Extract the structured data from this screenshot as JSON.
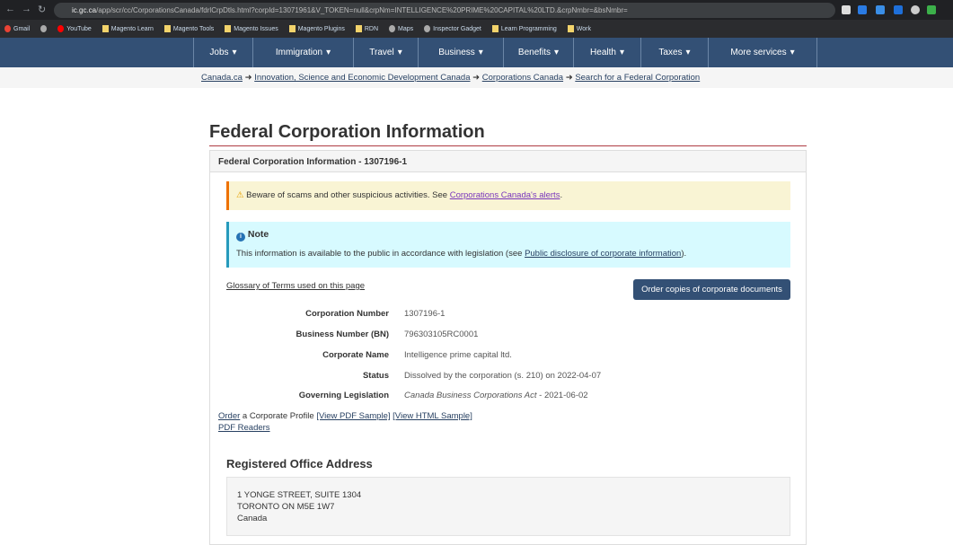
{
  "browser": {
    "url_host": "ic.gc.ca",
    "url_path": "/app/scr/cc/CorporationsCanada/fdrlCrpDtls.html?corpId=13071961&V_TOKEN=null&crpNm=INTELLIGENCE%20PRIME%20CAPITAL%20LTD.&crpNmbr=&bsNmbr=",
    "bookmarks": [
      "Gmail",
      "",
      "YouTube",
      "Magento Learn",
      "Magento Tools",
      "Magento Issues",
      "Magento Plugins",
      "RDN",
      "Maps",
      "Inspector Gadget",
      "Learn Programming",
      "Work"
    ]
  },
  "nav": [
    {
      "label": "Jobs",
      "w": 66
    },
    {
      "label": "Immigration",
      "w": 112
    },
    {
      "label": "Travel",
      "w": 72
    },
    {
      "label": "Business",
      "w": 95
    },
    {
      "label": "Benefits",
      "w": 78
    },
    {
      "label": "Health",
      "w": 75
    },
    {
      "label": "Taxes",
      "w": 75
    },
    {
      "label": "More services",
      "w": 122
    }
  ],
  "breadcrumb": [
    "Canada.ca",
    "Innovation, Science and Economic Development Canada",
    "Corporations Canada",
    "Search for a Federal Corporation"
  ],
  "page": {
    "title": "Federal Corporation Information",
    "panel_heading": "Federal Corporation Information - 1307196-1",
    "warning_text": "Beware of scams and other suspicious activities. See ",
    "warning_link": "Corporations Canada's alerts",
    "warning_end": ".",
    "note_title": "Note",
    "note_text": "This information is available to the public in accordance with legislation (see ",
    "note_link": "Public disclosure of corporate information",
    "note_end": ").",
    "glossary": "Glossary of Terms used on this page",
    "order_button": "Order copies of corporate documents",
    "fields": [
      {
        "label": "Corporation Number",
        "value": "1307196-1"
      },
      {
        "label": "Business Number (BN)",
        "value": "796303105RC0001"
      },
      {
        "label": "Corporate Name",
        "value": "Intelligence prime capital ltd."
      },
      {
        "label": "Status",
        "value": "Dissolved by the corporation (s. 210) on 2022-04-07"
      }
    ],
    "legislation": {
      "label": "Governing Legislation",
      "act": "Canada Business Corporations Act",
      "date": " - 2021-06-02"
    },
    "profile": {
      "order": "Order",
      "text": " a Corporate Profile ",
      "pdf": "[View PDF Sample]",
      "html": "[View HTML Sample]",
      "readers": "PDF Readers"
    },
    "registered_heading": "Registered Office Address",
    "address": [
      "1 YONGE STREET, SUITE 1304",
      "TORONTO ON M5E 1W7",
      "Canada"
    ]
  }
}
